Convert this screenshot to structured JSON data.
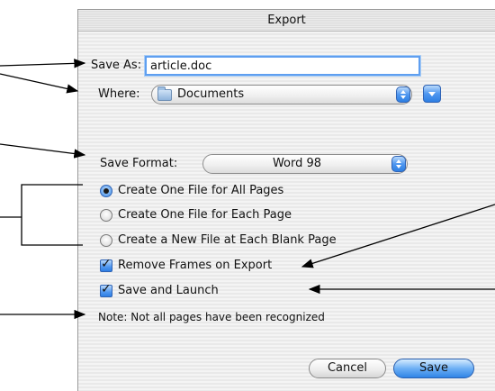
{
  "dialog": {
    "title": "Export",
    "save_as": {
      "label": "Save As:",
      "value": "article.doc"
    },
    "where": {
      "label": "Where:",
      "value": "Documents",
      "icon": "folder-icon"
    },
    "save_format": {
      "label": "Save Format:",
      "value": "Word 98"
    },
    "page_options": [
      {
        "label": "Create One File for All Pages",
        "selected": true
      },
      {
        "label": "Create One File for Each Page",
        "selected": false
      },
      {
        "label": "Create a New File at Each Blank Page",
        "selected": false
      }
    ],
    "checkboxes": [
      {
        "label": "Remove Frames on Export",
        "checked": true
      },
      {
        "label": "Save and Launch",
        "checked": true
      }
    ],
    "note": "Note: Not all pages have been recognized",
    "buttons": {
      "cancel": "Cancel",
      "save": "Save"
    }
  },
  "colors": {
    "accent": "#3f8de9",
    "focus_ring": "#5f9ff0",
    "callout": "#000000"
  }
}
